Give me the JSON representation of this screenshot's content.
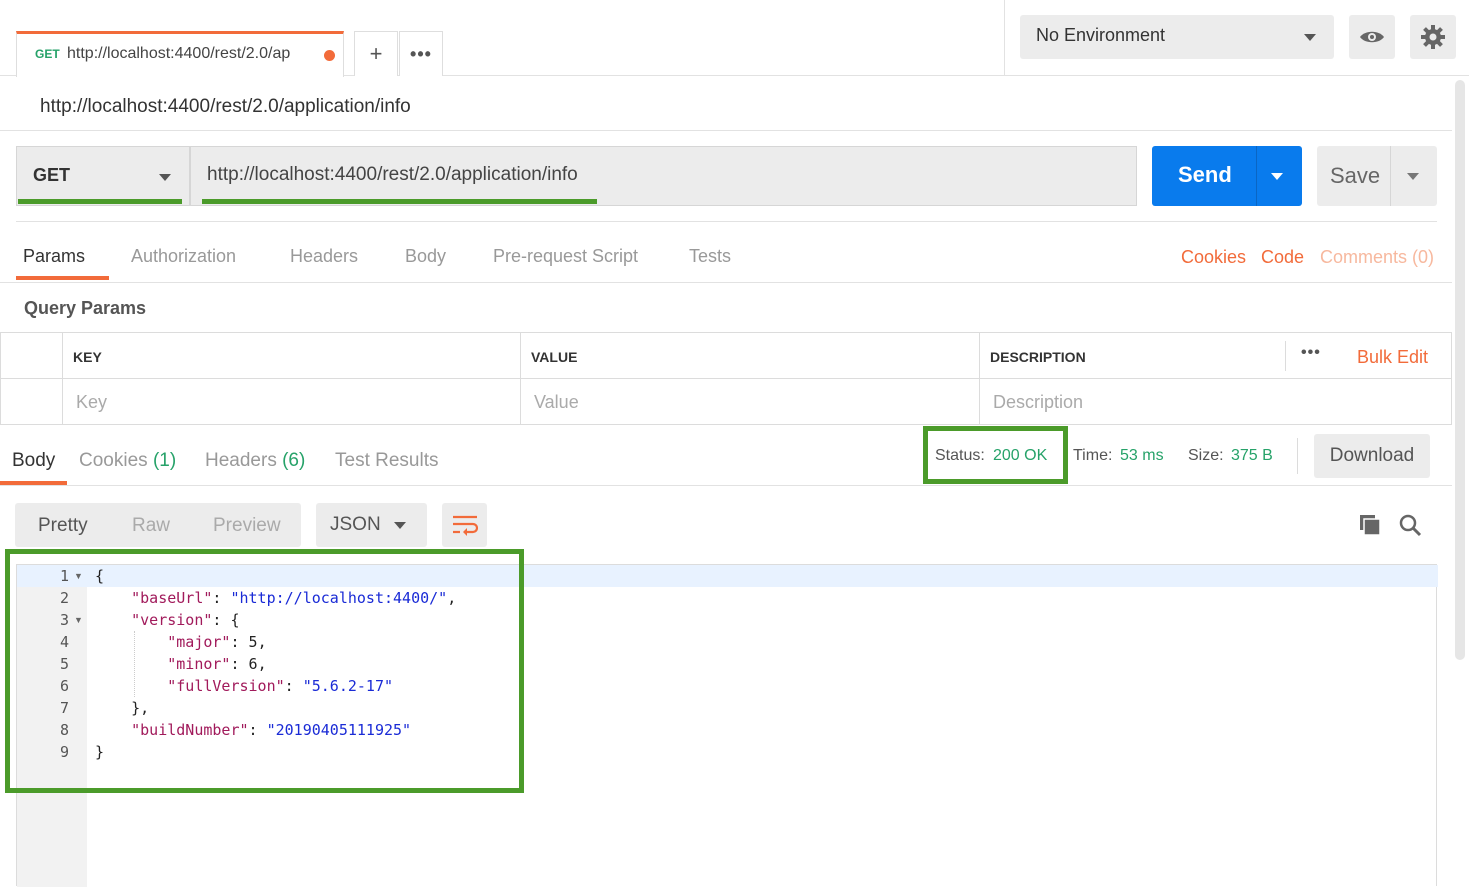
{
  "tab": {
    "method": "GET",
    "url": "http://localhost:4400/rest/2.0/ap"
  },
  "environment": {
    "selected": "No Environment"
  },
  "request": {
    "title": "http://localhost:4400/rest/2.0/application/info",
    "method": "GET",
    "url": "http://localhost:4400/rest/2.0/application/info",
    "send_label": "Send",
    "save_label": "Save"
  },
  "request_tabs": [
    "Params",
    "Authorization",
    "Headers",
    "Body",
    "Pre-request Script",
    "Tests"
  ],
  "request_links": {
    "cookies": "Cookies",
    "code": "Code",
    "comments": "Comments (0)"
  },
  "params": {
    "title": "Query Params",
    "headers": {
      "key": "KEY",
      "value": "VALUE",
      "description": "DESCRIPTION"
    },
    "bulk_edit": "Bulk Edit",
    "placeholders": {
      "key": "Key",
      "value": "Value",
      "description": "Description"
    }
  },
  "response": {
    "tabs": {
      "body": "Body",
      "cookies": "Cookies",
      "cookies_count": "(1)",
      "headers": "Headers",
      "headers_count": "(6)",
      "tests": "Test Results"
    },
    "status_label": "Status:",
    "status_value": "200 OK",
    "time_label": "Time:",
    "time_value": "53 ms",
    "size_label": "Size:",
    "size_value": "375 B",
    "download_label": "Download",
    "view_modes": [
      "Pretty",
      "Raw",
      "Preview"
    ],
    "format": "JSON"
  },
  "code": {
    "line_numbers": [
      "1",
      "2",
      "3",
      "4",
      "5",
      "6",
      "7",
      "8",
      "9"
    ],
    "l1": "{",
    "baseUrl_key": "\"baseUrl\"",
    "baseUrl_val": "\"http://localhost:4400/\"",
    "version_key": "\"version\"",
    "major_key": "\"major\"",
    "major_val": "5",
    "minor_key": "\"minor\"",
    "minor_val": "6",
    "full_key": "\"fullVersion\"",
    "full_val": "\"5.6.2-17\"",
    "l7": "},",
    "build_key": "\"buildNumber\"",
    "build_val": "\"20190405111925\"",
    "l9": "}"
  },
  "colors": {
    "accent": "#f26b3a",
    "send": "#097bed",
    "status_green": "#26a269",
    "highlight_green": "#4b9b2a"
  }
}
